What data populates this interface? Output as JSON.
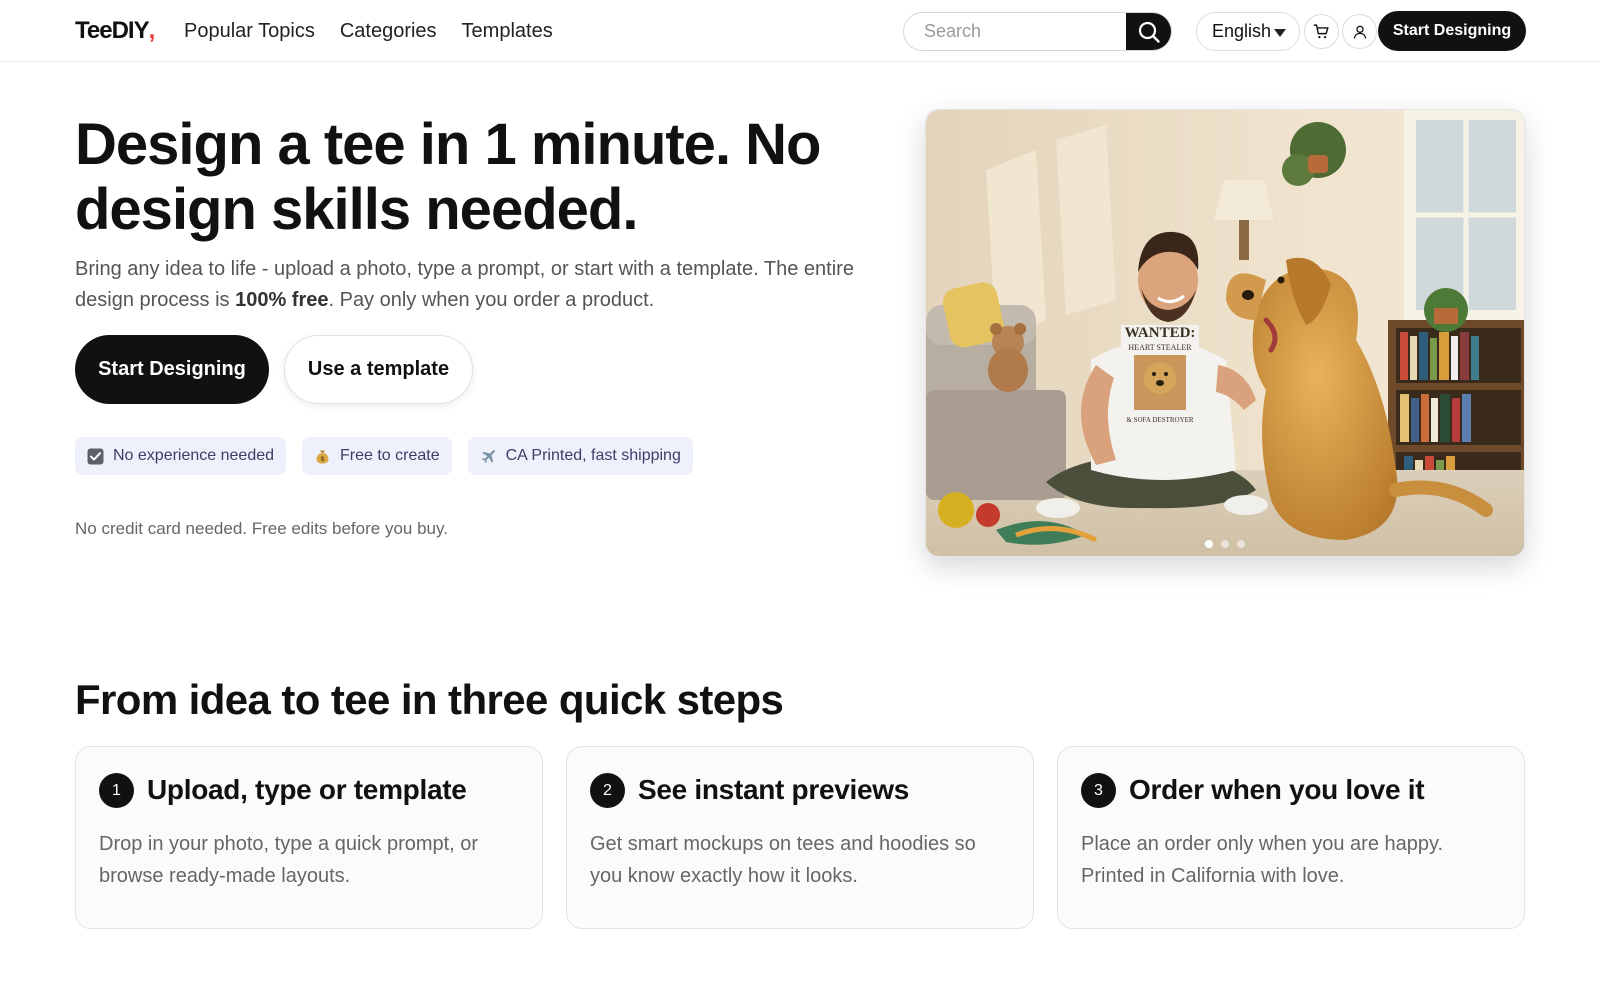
{
  "brand": {
    "name_main": "TeeDIY",
    "name_accent": ",",
    "accent_color": "#e63a32"
  },
  "nav": [
    {
      "label": "Popular Topics"
    },
    {
      "label": "Categories"
    },
    {
      "label": "Templates"
    }
  ],
  "search": {
    "placeholder": "Search",
    "value": ""
  },
  "language": {
    "selected": "English"
  },
  "header": {
    "cta_label": "Start Designing"
  },
  "hero": {
    "title": "Design a tee in 1 minute. No design skills needed.",
    "subtitle_part1": "Bring any idea to life - upload a photo, type a prompt, or start with a template. The entire design process is ",
    "subtitle_bold": "100% free",
    "subtitle_part2": ". Pay only when you order a product.",
    "primary_cta": "Start Designing",
    "secondary_cta": "Use a template",
    "chips": [
      {
        "icon": "checkbox-icon",
        "label": "No experience needed"
      },
      {
        "icon": "money-bag-icon",
        "label": "Free to create"
      },
      {
        "icon": "airplane-icon",
        "label": "CA Printed, fast shipping"
      }
    ],
    "note": "No credit card needed. Free edits before you buy.",
    "shirt_text": {
      "line1": "WANTED:",
      "line2": "HEART STEALER",
      "line3": "& SOFA DESTROYER"
    },
    "carousel": {
      "total": 3,
      "active": 1
    }
  },
  "steps_section": {
    "title": "From idea to tee in three quick steps",
    "steps": [
      {
        "number": "1",
        "title": "Upload, type or template",
        "text": "Drop in your photo, type a quick prompt, or browse ready-made layouts."
      },
      {
        "number": "2",
        "title": "See instant previews",
        "text": "Get smart mockups on tees and hoodies so you know exactly how it looks."
      },
      {
        "number": "3",
        "title": "Order when you love it",
        "text": "Place an order only when you are happy. Printed in California with love."
      }
    ]
  }
}
